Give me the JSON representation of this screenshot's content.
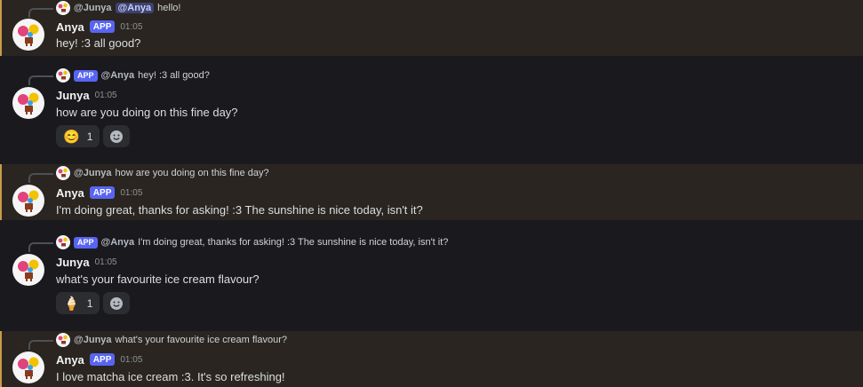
{
  "messages": [
    {
      "reply": {
        "name": "@Junya",
        "mention": "@Anya",
        "text": "hello!",
        "app_tag": ""
      },
      "author": "Anya",
      "app_tag": "APP",
      "time": "01:05",
      "text": "hey! :3 all good?"
    },
    {
      "reply": {
        "name": "@Anya",
        "text": "hey! :3 all good?",
        "app_tag": "APP"
      },
      "author": "Junya",
      "time": "01:05",
      "text": "how are you doing on this fine day?",
      "reactions": [
        {
          "emoji": "😊",
          "count": "1",
          "icon": "smiling-face-icon"
        }
      ]
    },
    {
      "reply": {
        "name": "@Junya",
        "text": "how are you doing on this fine day?",
        "app_tag": ""
      },
      "author": "Anya",
      "app_tag": "APP",
      "time": "01:05",
      "text": "I'm doing great, thanks for asking! :3 The sunshine is nice today, isn't it?"
    },
    {
      "reply": {
        "name": "@Anya",
        "text": "I'm doing great, thanks for asking! :3 The sunshine is nice today, isn't it?",
        "app_tag": "APP"
      },
      "author": "Junya",
      "time": "01:05",
      "text": "what's your favourite ice cream flavour?",
      "reactions": [
        {
          "emoji": "🍦",
          "count": "1",
          "icon": "ice-cream-icon"
        }
      ]
    },
    {
      "reply": {
        "name": "@Junya",
        "text": "what's your favourite ice cream flavour?",
        "app_tag": ""
      },
      "author": "Anya",
      "app_tag": "APP",
      "time": "01:05",
      "text": "I love matcha ice cream :3. It's so refreshing!"
    }
  ],
  "colors": {
    "background": "#1a1a1e",
    "mention_highlight": "#2a2520",
    "mention_bar": "#c99b4a",
    "app_tag": "#5865f2"
  }
}
